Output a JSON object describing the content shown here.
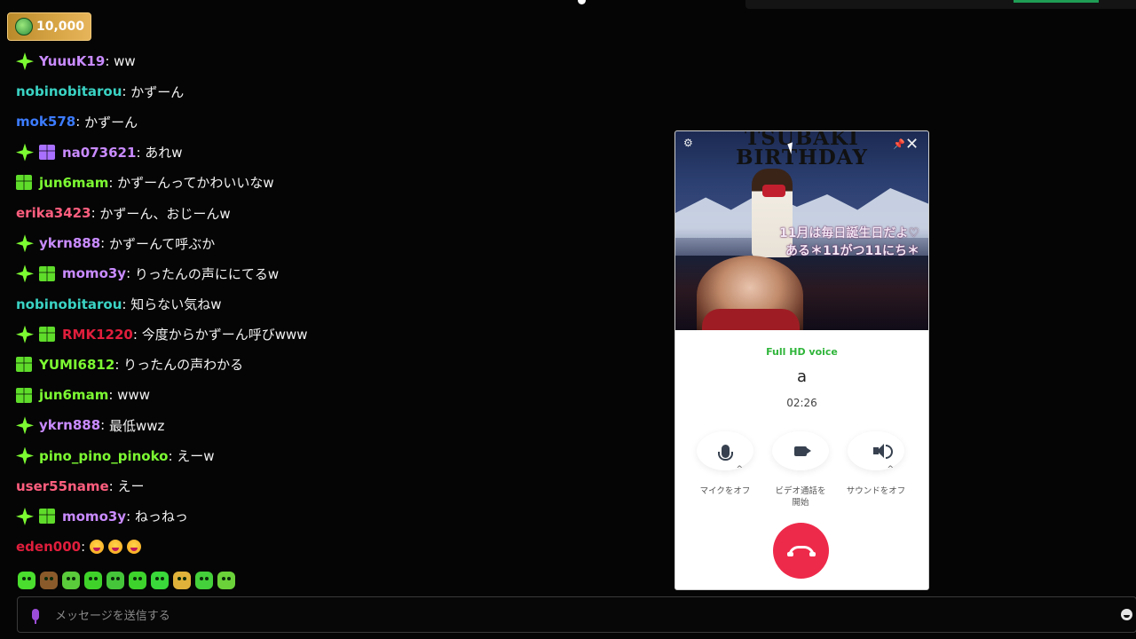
{
  "coin_badge": {
    "amount": "10,000",
    "icon": "coin-icon"
  },
  "chat": [
    {
      "user": "YuuuK19",
      "user_color": "#c98bff",
      "badges": [
        "star"
      ],
      "message": "ww"
    },
    {
      "user": "nobinobitarou",
      "user_color": "#3ad3c4",
      "badges": [],
      "message": "かずーん"
    },
    {
      "user": "mok578",
      "user_color": "#3c7cff",
      "badges": [],
      "message": "かずーん"
    },
    {
      "user": "na073621",
      "user_color": "#c98bff",
      "badges": [
        "star",
        "gift-purple"
      ],
      "message": "あれw"
    },
    {
      "user": "jun6mam",
      "user_color": "#7cfa32",
      "badges": [
        "gift-green"
      ],
      "message": "かずーんってかわいいなw"
    },
    {
      "user": "erika3423",
      "user_color": "#ff5e7e",
      "badges": [],
      "message": "かずーん、おじーんw"
    },
    {
      "user": "ykrn888",
      "user_color": "#c98bff",
      "badges": [
        "star"
      ],
      "message": "かずーんて呼ぶか"
    },
    {
      "user": "momo3y",
      "user_color": "#c98bff",
      "badges": [
        "star",
        "gift-green"
      ],
      "message": "りったんの声ににてるw"
    },
    {
      "user": "nobinobitarou",
      "user_color": "#3ad3c4",
      "badges": [],
      "message": "知らない気ねw"
    },
    {
      "user": "RMK1220",
      "user_color": "#e01e3c",
      "badges": [
        "star",
        "gift-green"
      ],
      "message": "今度からかずーん呼びwww"
    },
    {
      "user": "YUMI6812",
      "user_color": "#7cfa32",
      "badges": [
        "gift-green"
      ],
      "message": "りったんの声わかる"
    },
    {
      "user": "jun6mam",
      "user_color": "#7cfa32",
      "badges": [
        "gift-green"
      ],
      "message": "www"
    },
    {
      "user": "ykrn888",
      "user_color": "#c98bff",
      "badges": [
        "star"
      ],
      "message": "最低wwz"
    },
    {
      "user": "pino_pino_pinoko",
      "user_color": "#7cfa32",
      "badges": [
        "star"
      ],
      "message": "えーw"
    },
    {
      "user": "user55name",
      "user_color": "#ff5e7e",
      "badges": [],
      "message": "えー"
    },
    {
      "user": "momo3y",
      "user_color": "#c98bff",
      "badges": [
        "star",
        "gift-green"
      ],
      "message": "ねっねっ"
    },
    {
      "user": "eden000",
      "user_color": "#e01e3c",
      "badges": [],
      "message": "",
      "emojis": [
        "laugh",
        "laugh",
        "laugh"
      ]
    }
  ],
  "emote_bar": [
    "#4ade2e",
    "#8a5a2b",
    "#5acb3a",
    "#3fd32a",
    "#45c63a",
    "#3ed22c",
    "#3ad83a",
    "#e0b23a",
    "#44d03a",
    "#6bd23a"
  ],
  "input": {
    "placeholder": "メッセージを送信する"
  },
  "call": {
    "banner": {
      "title_line1": "TSUBAKI",
      "title_line2": "BIRTHDAY",
      "jp_line1": "11月は毎日誕生日だよ♡",
      "jp_line2": "ある＊11がつ11にち＊"
    },
    "quality": "Full HD voice",
    "caller": "a",
    "duration": "02:26",
    "controls": {
      "mic_label": "マイクをオフ",
      "video_label_1": "ビデオ通話を",
      "video_label_2": "開始",
      "sound_label": "サウンドをオフ"
    },
    "close_symbol": "✕",
    "settings_symbol": "⚙",
    "pin_symbol": "📌"
  }
}
